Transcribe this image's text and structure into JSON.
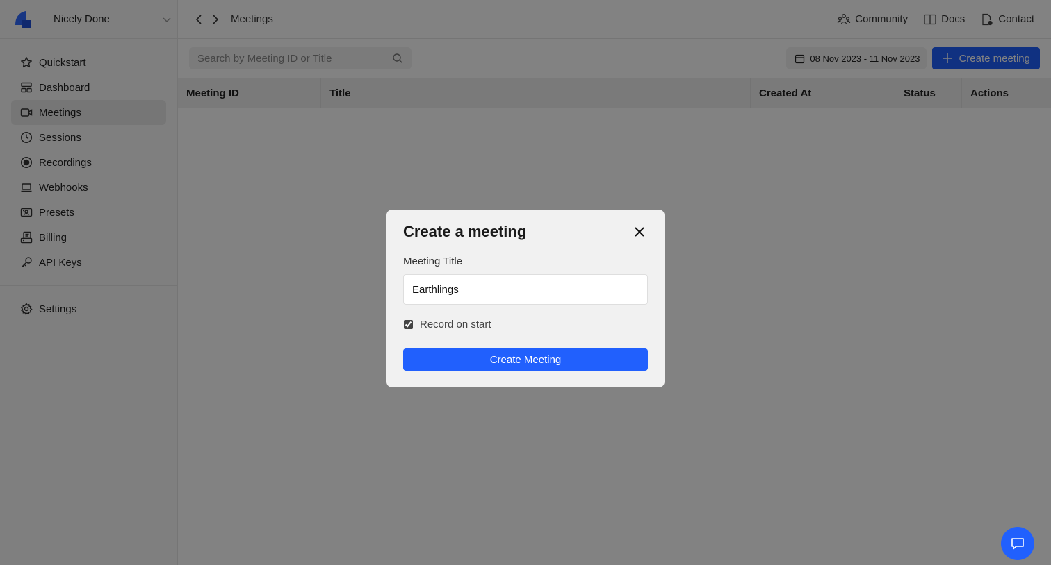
{
  "org": {
    "name": "Nicely Done"
  },
  "sidebar": {
    "items": [
      {
        "label": "Quickstart",
        "icon": "star-icon"
      },
      {
        "label": "Dashboard",
        "icon": "dashboard-icon"
      },
      {
        "label": "Meetings",
        "icon": "video-icon",
        "active": true
      },
      {
        "label": "Sessions",
        "icon": "clock-icon"
      },
      {
        "label": "Recordings",
        "icon": "record-icon"
      },
      {
        "label": "Webhooks",
        "icon": "laptop-icon"
      },
      {
        "label": "Presets",
        "icon": "presets-icon"
      },
      {
        "label": "Billing",
        "icon": "billing-icon"
      },
      {
        "label": "API Keys",
        "icon": "key-icon"
      }
    ],
    "settings": {
      "label": "Settings",
      "icon": "gear-icon"
    }
  },
  "topbar": {
    "breadcrumb": "Meetings",
    "links": {
      "community": "Community",
      "docs": "Docs",
      "contact": "Contact"
    }
  },
  "toolbar": {
    "search_placeholder": "Search by Meeting ID or Title",
    "date_range": "08 Nov 2023 - 11 Nov 2023",
    "create_label": "Create meeting"
  },
  "table": {
    "columns": [
      "Meeting ID",
      "Title",
      "Created At",
      "Status",
      "Actions"
    ],
    "rows": []
  },
  "modal": {
    "title": "Create a meeting",
    "field_label": "Meeting Title",
    "field_value": "Earthlings",
    "checkbox_label": "Record on start",
    "checkbox_checked": true,
    "submit_label": "Create Meeting"
  },
  "colors": {
    "accent": "#2160fd",
    "logo_light": "#5b8cff",
    "logo_dark": "#1e4fd8"
  }
}
